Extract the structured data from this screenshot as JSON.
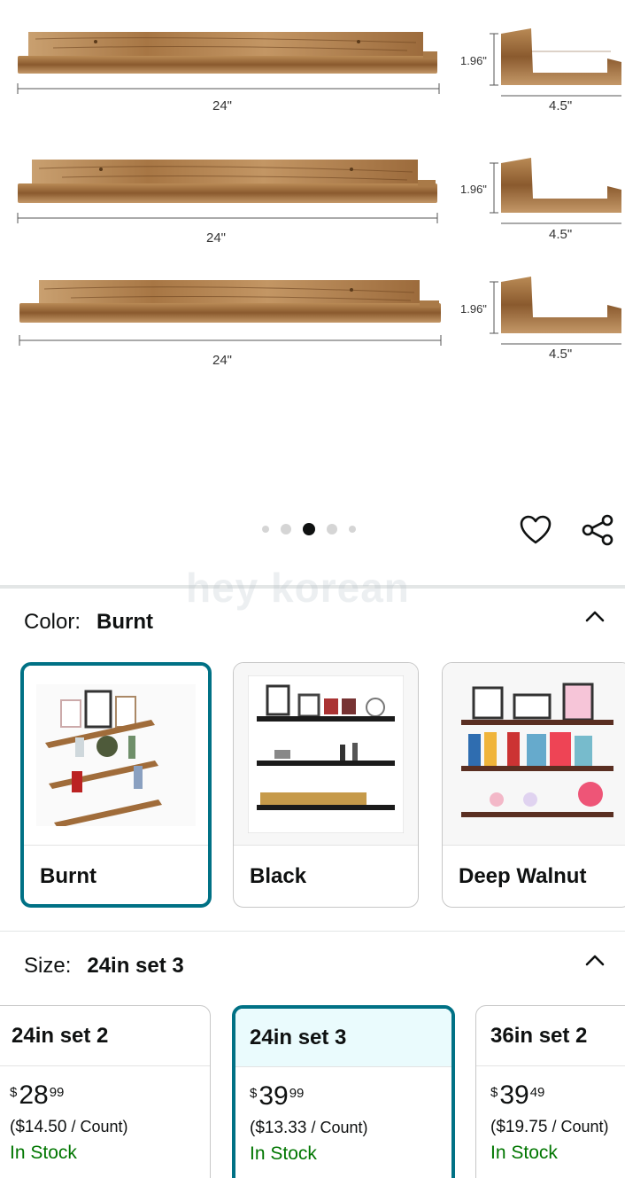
{
  "product_image": {
    "shelves": [
      {
        "length_label": "24\"",
        "height_label": "1.96\"",
        "depth_label": "4.5\""
      },
      {
        "length_label": "24\"",
        "height_label": "1.96\"",
        "depth_label": "4.5\""
      },
      {
        "length_label": "24\"",
        "height_label": "1.96\"",
        "depth_label": "4.5\""
      }
    ],
    "carousel_total": 5,
    "carousel_active_index": 2
  },
  "watermark": "hey korean",
  "color": {
    "label": "Color:",
    "selected": "Burnt",
    "options": [
      {
        "name": "Burnt"
      },
      {
        "name": "Black"
      },
      {
        "name": "Deep Walnut"
      }
    ]
  },
  "size": {
    "label": "Size:",
    "selected": "24in set 3",
    "options": [
      {
        "name": "24in set 2",
        "currency": "$",
        "price_whole": "28",
        "price_fraction": "99",
        "unit_price": "($14.50",
        "unit_per": " / Count)",
        "availability": "In Stock"
      },
      {
        "name": "24in set 3",
        "currency": "$",
        "price_whole": "39",
        "price_fraction": "99",
        "unit_price": "($13.33",
        "unit_per": " / Count)",
        "availability": "In Stock"
      },
      {
        "name": "36in set 2",
        "currency": "$",
        "price_whole": "39",
        "price_fraction": "49",
        "unit_price": "($19.75",
        "unit_per": " / Count)",
        "availability": "In Stock"
      }
    ]
  },
  "colors": {
    "accent": "#007185",
    "in_stock": "#007600",
    "selected_bg": "#eafbfd"
  },
  "icons": {
    "wishlist": "heart-icon",
    "share": "share-icon",
    "collapse": "chevron-up-icon"
  }
}
